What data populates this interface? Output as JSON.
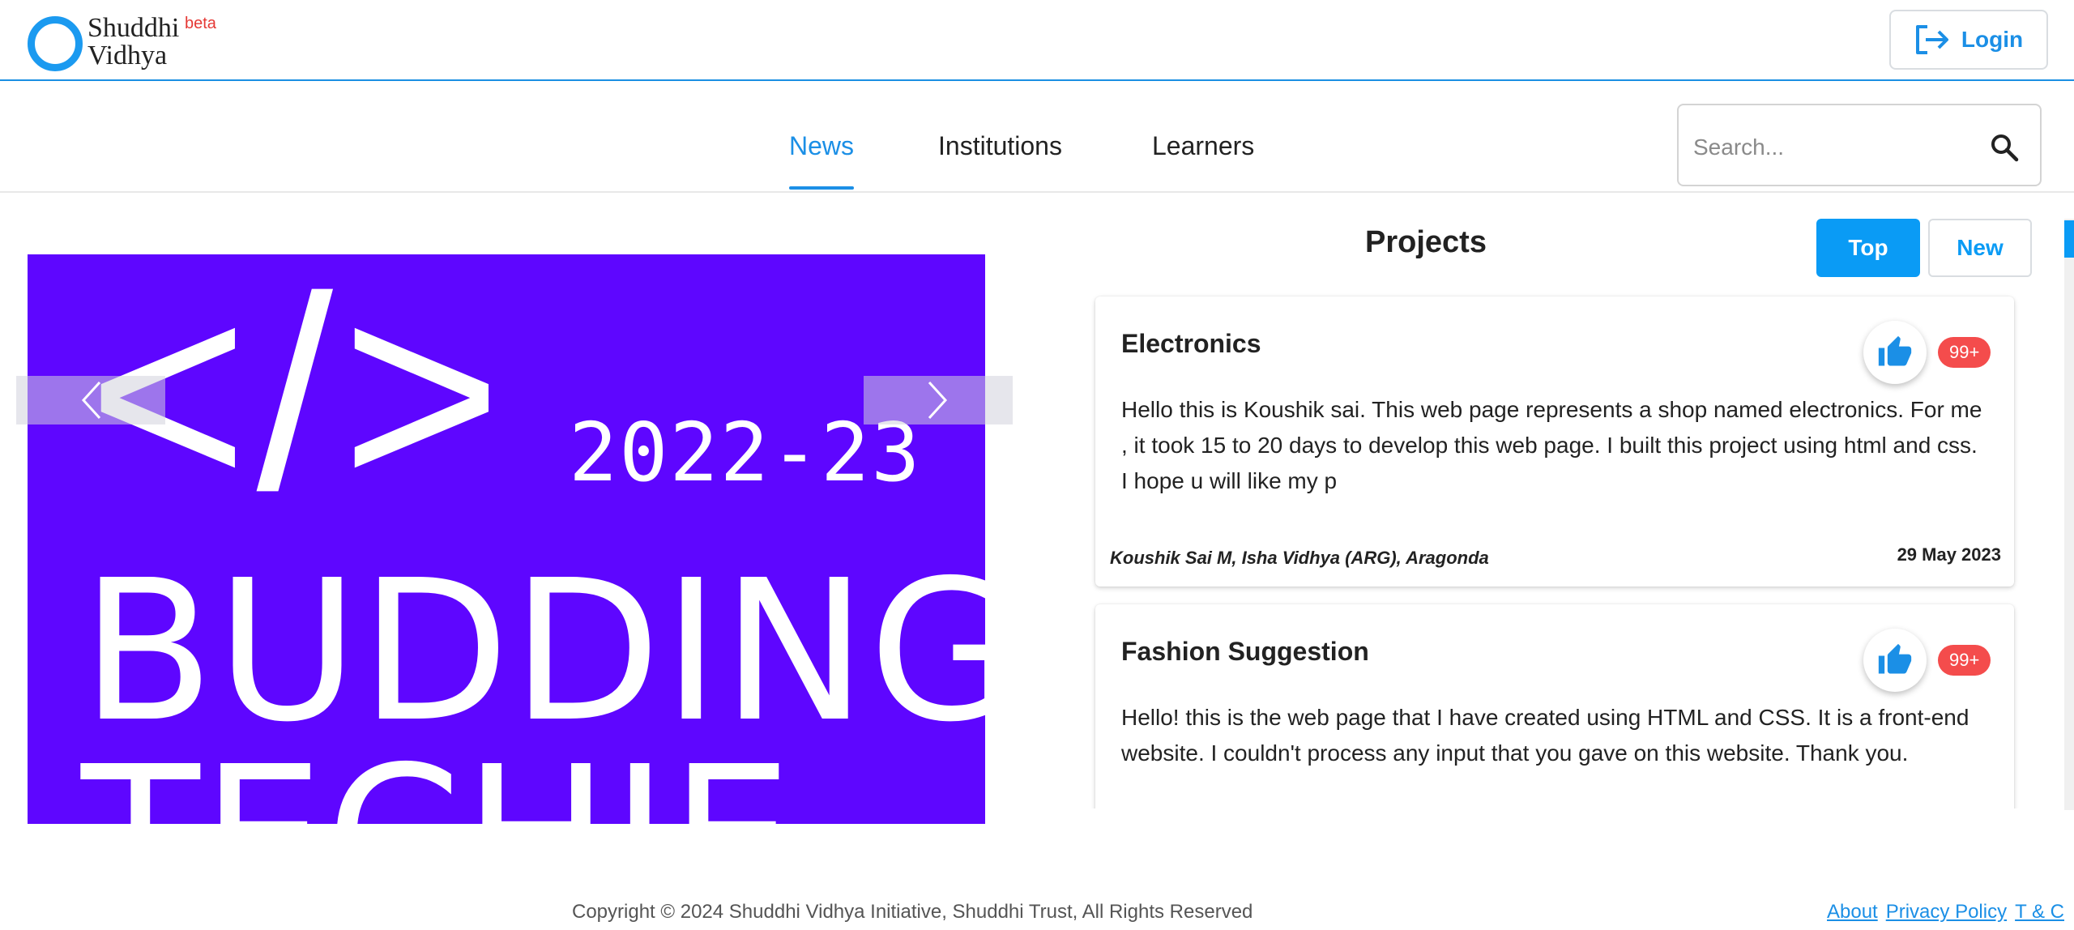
{
  "header": {
    "logo_line1": "Shuddhi",
    "logo_line2": "Vidhya",
    "logo_beta": "beta",
    "login_label": "Login"
  },
  "nav": {
    "tabs": [
      {
        "label": "News",
        "active": true
      },
      {
        "label": "Institutions",
        "active": false
      },
      {
        "label": "Learners",
        "active": false
      }
    ],
    "search_placeholder": "Search..."
  },
  "banner": {
    "code_symbol": "</>",
    "year": "2022-23",
    "line1": "BUDDING",
    "line2": "TECHIE"
  },
  "projects": {
    "title": "Projects",
    "sort_top": "Top",
    "sort_new": "New",
    "cards": [
      {
        "title": "Electronics",
        "body": "Hello this is Koushik sai. This web page represents a shop named electronics. For me , it took 15 to 20 days to develop this web page. I built this project using html and css. I hope u will like my p",
        "author": "Koushik Sai M, Isha Vidhya (ARG), Aragonda",
        "date": "29 May 2023",
        "likes": "99+"
      },
      {
        "title": "Fashion Suggestion",
        "body": "Hello! this is the web page that I have created using HTML and CSS. It is a front-end website. I couldn't process any input that you gave on this website. Thank you.",
        "likes": "99+"
      }
    ]
  },
  "footer": {
    "copyright": "Copyright © 2024 Shuddhi Vidhya Initiative, Shuddhi Trust, All Rights Reserved",
    "links": [
      "About",
      "Privacy Policy",
      "T & C"
    ]
  },
  "colors": {
    "accent": "#1b8fe6",
    "banner_bg": "#5e06ff",
    "badge": "#f44c4c"
  }
}
